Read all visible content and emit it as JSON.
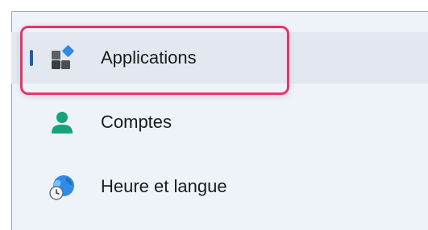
{
  "nav": {
    "items": [
      {
        "label": "Applications",
        "icon": "apps-icon",
        "selected": true
      },
      {
        "label": "Comptes",
        "icon": "person-icon",
        "selected": false
      },
      {
        "label": "Heure et langue",
        "icon": "globe-clock-icon",
        "selected": false
      }
    ]
  },
  "colors": {
    "pane_background": "#eef2f9",
    "selected_background": "#e3e8f0",
    "selection_indicator": "#1a5fb4",
    "highlight_border": "#e8336a",
    "text": "#1b1b1b",
    "person_icon": "#15a37a"
  }
}
